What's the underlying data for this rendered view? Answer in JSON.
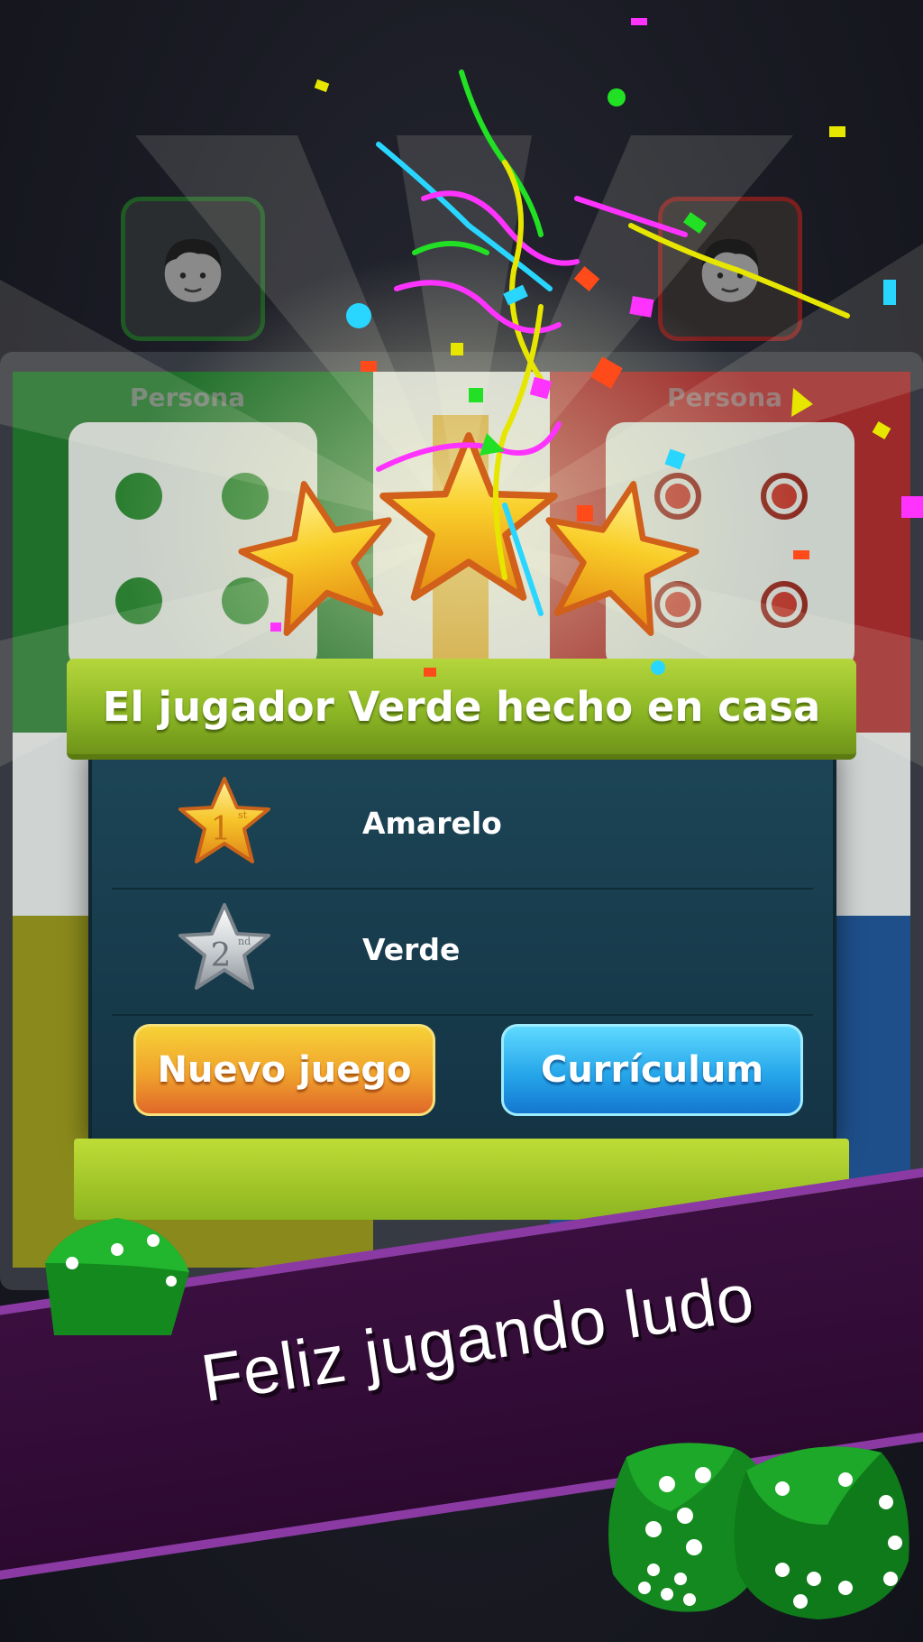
{
  "players": {
    "left_label": "Persona",
    "right_label": "Persona"
  },
  "result": {
    "title": "El jugador Verde hecho en casa",
    "ranks": [
      {
        "position": "1",
        "suffix": "st",
        "name": "Amarelo",
        "medal": "gold-star-icon"
      },
      {
        "position": "2",
        "suffix": "nd",
        "name": "Verde",
        "medal": "silver-star-icon"
      }
    ],
    "stars_earned": 3,
    "buttons": {
      "new_game": "Nuevo juego",
      "summary": "Currículum"
    }
  },
  "promo": {
    "slogan": "Feliz jugando ludo"
  },
  "colors": {
    "green": "#1f6e2a",
    "red": "#9c2a2a",
    "yellow": "#8a8a1c",
    "blue": "#1e4f8a",
    "banner": "#8db726",
    "ribbon": "#2c0a30"
  }
}
